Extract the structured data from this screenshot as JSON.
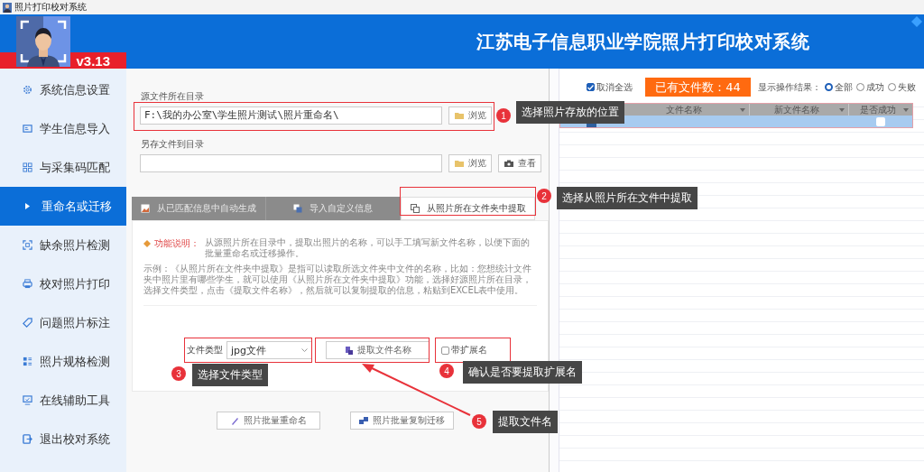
{
  "window": {
    "title": "照片打印校对系统"
  },
  "header": {
    "version": "v3.13",
    "title": "江苏电子信息职业学院照片打印校对系统"
  },
  "sidebar": {
    "items": [
      {
        "label": "系统信息设置",
        "selected": false
      },
      {
        "label": "学生信息导入",
        "selected": false
      },
      {
        "label": "与采集码匹配",
        "selected": false
      },
      {
        "label": "重命名或迁移",
        "selected": true
      },
      {
        "label": "缺余照片检测",
        "selected": false
      },
      {
        "label": "校对照片打印",
        "selected": false
      },
      {
        "label": "问题照片标注",
        "selected": false
      },
      {
        "label": "照片规格检测",
        "selected": false
      },
      {
        "label": "在线辅助工具",
        "selected": false
      },
      {
        "label": "退出校对系统",
        "selected": false
      }
    ]
  },
  "source_dir": {
    "label": "源文件所在目录",
    "value": "F:\\我的办公室\\学生照片测试\\照片重命名\\",
    "browse_button": "浏览"
  },
  "target_dir": {
    "label": "另存文件到目录",
    "browse_button": "浏览",
    "view_button": "查看"
  },
  "tabs": [
    {
      "label": "从已匹配信息中自动生成",
      "selected": false
    },
    {
      "label": "导入自定义信息",
      "selected": false
    },
    {
      "label": "从照片所在文件夹中提取",
      "selected": true
    }
  ],
  "description": {
    "label": "功能说明：",
    "text": "从源照片所在目录中，提取出照片的名称，可以手工填写新文件名称，以便下面的批量重命名或迁移操作。",
    "example": "示例：《从照片所在文件夹中提取》是指可以读取所选文件夹中文件的名称，比如：您想统计文件夹中照片里有哪些学生，就可以使用《从照片所在文件夹中提取》功能，选择好源照片所在目录，选择文件类型，点击《提取文件名称》，然后就可以复制提取的信息，粘贴到EXCEL表中使用。"
  },
  "file_type": {
    "label": "文件类型",
    "value": "jpg文件"
  },
  "extract_button": "提取文件名称",
  "with_extension": {
    "label": "带扩展名",
    "checked": false
  },
  "batch_buttons": [
    "照片批量重命名",
    "照片批量复制迁移"
  ],
  "toolbar": {
    "select_all": {
      "label": "取消全选",
      "checked": true
    },
    "file_count": "已有文件数：44",
    "result_label": "显示操作结果：",
    "result_options": [
      {
        "label": "全部",
        "selected": true
      },
      {
        "label": "成功",
        "selected": false
      },
      {
        "label": "失败",
        "selected": false
      }
    ]
  },
  "table": {
    "columns": [
      "文件名称",
      "新文件名称",
      "是否成功"
    ],
    "rows": [
      {
        "selected": true,
        "success": false
      }
    ]
  },
  "annotations": [
    {
      "number": "1",
      "text": "选择照片存放的位置",
      "arrow": false
    },
    {
      "number": "2",
      "text": "选择从照片所在文件中提取",
      "arrow": false
    },
    {
      "number": "3",
      "text": "选择文件类型",
      "arrow": false
    },
    {
      "number": "4",
      "text": "确认是否要提取扩展名",
      "arrow": false
    },
    {
      "number": "5",
      "text": "提取文件名",
      "arrow": true
    }
  ]
}
